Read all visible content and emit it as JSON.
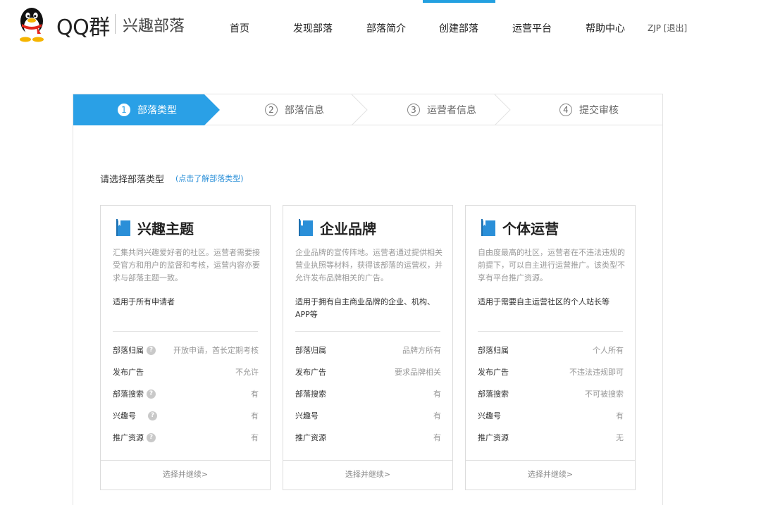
{
  "header": {
    "brand": "QQ群",
    "subtitle": "兴趣部落",
    "nav": [
      "首页",
      "发现部落",
      "部落简介",
      "创建部落",
      "运营平台",
      "帮助中心"
    ],
    "active_nav": "创建部落",
    "user": "ZJP",
    "logout": "[退出]"
  },
  "steps": [
    {
      "num": "1",
      "label": "部落类型",
      "active": true
    },
    {
      "num": "2",
      "label": "部落信息",
      "active": false
    },
    {
      "num": "3",
      "label": "运营者信息",
      "active": false
    },
    {
      "num": "4",
      "label": "提交审核",
      "active": false
    }
  ],
  "prompt": {
    "text": "请选择部落类型",
    "link": "(点击了解部落类型)"
  },
  "cards": [
    {
      "title": "兴趣主题",
      "desc": "汇集共同兴趣爱好者的社区。运营者需要接受官方和用户的监督和考核，运营内容亦要求与部落主题一致。",
      "target": "适用于所有申请者",
      "rows": [
        {
          "label": "部落归属",
          "value": "开放申请，酋长定期考核"
        },
        {
          "label": "发布广告",
          "value": "不允许"
        },
        {
          "label": "部落搜索",
          "value": "有"
        },
        {
          "label": "兴趣号",
          "value": "有"
        },
        {
          "label": "推广资源",
          "value": "有"
        }
      ],
      "action": "选择并继续>"
    },
    {
      "title": "企业品牌",
      "desc": "企业品牌的宣传阵地。运营者通过提供相关营业执照等材料，获得该部落的运营权，并允许发布品牌相关的广告。",
      "target": "适用于拥有自主商业品牌的企业、机构、APP等",
      "rows": [
        {
          "label": "部落归属",
          "value": "品牌方所有"
        },
        {
          "label": "发布广告",
          "value": "要求品牌相关"
        },
        {
          "label": "部落搜索",
          "value": "有"
        },
        {
          "label": "兴趣号",
          "value": "有"
        },
        {
          "label": "推广资源",
          "value": "有"
        }
      ],
      "action": "选择并继续>"
    },
    {
      "title": "个体运营",
      "desc": "自由度最高的社区，运营者在不违法违规的前提下，可以自主进行运营推广。该类型不享有平台推广资源。",
      "target": "适用于需要自主运营社区的个人站长等",
      "rows": [
        {
          "label": "部落归属",
          "value": "个人所有"
        },
        {
          "label": "发布广告",
          "value": "不违法违规即可"
        },
        {
          "label": "部落搜索",
          "value": "不可被搜索"
        },
        {
          "label": "兴趣号",
          "value": "有"
        },
        {
          "label": "推广资源",
          "value": "无"
        }
      ],
      "action": "选择并继续>"
    }
  ],
  "colors": {
    "accent": "#2aa0e6",
    "nav_active_bar": "#23a0e0",
    "link": "#2a8fd8",
    "book_icon": "#2a8fd8"
  }
}
